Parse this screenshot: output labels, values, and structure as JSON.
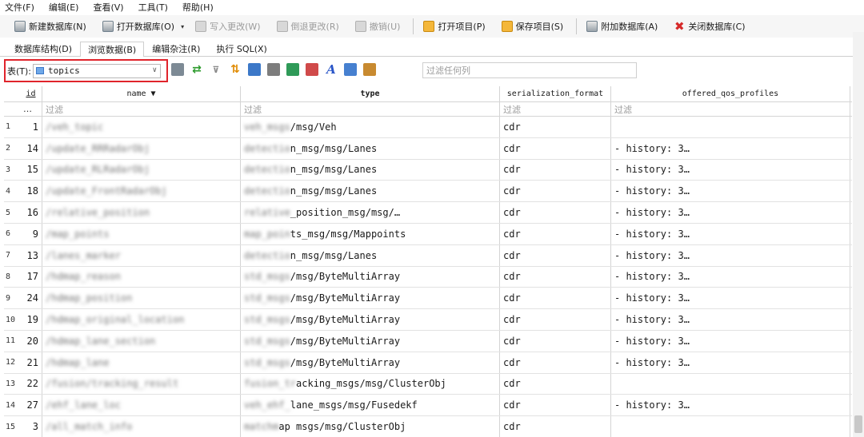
{
  "menu": [
    "文件(F)",
    "编辑(E)",
    "查看(V)",
    "工具(T)",
    "帮助(H)"
  ],
  "toolbar": {
    "new_db": "新建数据库(N)",
    "open_db": "打开数据库(O)",
    "write_changes": "写入更改(W)",
    "revert_changes": "倒退更改(R)",
    "undo": "撤销(U)",
    "open_project": "打开项目(P)",
    "save_project": "保存项目(S)",
    "attach_db": "附加数据库(A)",
    "close_db": "关闭数据库(C)"
  },
  "tabs": [
    "数据库结构(D)",
    "浏览数据(B)",
    "编辑杂注(R)",
    "执行 SQL(X)"
  ],
  "active_tab": 1,
  "table_selector": {
    "label": "表(T):",
    "value": "topics"
  },
  "filter_any_placeholder": "过滤任何列",
  "columns": {
    "id": "id",
    "name": "name ▼",
    "type": "type",
    "serialization_format": "serialization_format",
    "offered_qos_profiles": "offered_qos_profiles"
  },
  "filter_row": {
    "rownum": "…",
    "placeholder": "过滤"
  },
  "rows": [
    {
      "rn": "1",
      "id": "1",
      "name": "/veh_topic",
      "type_prefix": "veh_msgs",
      "type": "/msg/Veh",
      "ser": "cdr",
      "qos": ""
    },
    {
      "rn": "2",
      "id": "14",
      "name": "/update_RRRadarObj",
      "type_prefix": "detectio",
      "type": "n_msg/msg/Lanes",
      "ser": "cdr",
      "qos": "- history: 3…"
    },
    {
      "rn": "3",
      "id": "15",
      "name": "/update_RLRadarObj",
      "type_prefix": "detectio",
      "type": "n_msg/msg/Lanes",
      "ser": "cdr",
      "qos": "- history: 3…"
    },
    {
      "rn": "4",
      "id": "18",
      "name": "/update_FrontRadarObj",
      "type_prefix": "detectio",
      "type": "n_msg/msg/Lanes",
      "ser": "cdr",
      "qos": "- history: 3…"
    },
    {
      "rn": "5",
      "id": "16",
      "name": "/relative_position",
      "type_prefix": "relative",
      "type": "_position_msg/msg/…",
      "ser": "cdr",
      "qos": "- history: 3…"
    },
    {
      "rn": "6",
      "id": "9",
      "name": "/map_points",
      "type_prefix": "map_poin",
      "type": "ts_msg/msg/Mappoints",
      "ser": "cdr",
      "qos": "- history: 3…"
    },
    {
      "rn": "7",
      "id": "13",
      "name": "/lanes_marker",
      "type_prefix": "detectio",
      "type": "n_msg/msg/Lanes",
      "ser": "cdr",
      "qos": "- history: 3…"
    },
    {
      "rn": "8",
      "id": "17",
      "name": "/hdmap_reason",
      "type_prefix": "std_msgs",
      "type": "/msg/ByteMultiArray",
      "ser": "cdr",
      "qos": "- history: 3…"
    },
    {
      "rn": "9",
      "id": "24",
      "name": "/hdmap_position",
      "type_prefix": "std_msgs",
      "type": "/msg/ByteMultiArray",
      "ser": "cdr",
      "qos": "- history: 3…"
    },
    {
      "rn": "10",
      "id": "19",
      "name": "/hdmap_original_location",
      "type_prefix": "std_msgs",
      "type": "/msg/ByteMultiArray",
      "ser": "cdr",
      "qos": "- history: 3…"
    },
    {
      "rn": "11",
      "id": "20",
      "name": "/hdmap_lane_section",
      "type_prefix": "std_msgs",
      "type": "/msg/ByteMultiArray",
      "ser": "cdr",
      "qos": "- history: 3…"
    },
    {
      "rn": "12",
      "id": "21",
      "name": "/hdmap_lane",
      "type_prefix": "std_msgs",
      "type": "/msg/ByteMultiArray",
      "ser": "cdr",
      "qos": "- history: 3…"
    },
    {
      "rn": "13",
      "id": "22",
      "name": "/fusion/tracking_result",
      "type_prefix": "fusion_tr",
      "type": "acking_msgs/msg/ClusterObj",
      "ser": "cdr",
      "qos": ""
    },
    {
      "rn": "14",
      "id": "27",
      "name": "/ehf_lane_loc",
      "type_prefix": "veh_ehf_",
      "type": "lane_msgs/msg/Fusedekf",
      "ser": "cdr",
      "qos": "- history: 3…"
    },
    {
      "rn": "15",
      "id": "3",
      "name": "/all_match_info",
      "type_prefix": "matchm",
      "type": "ap msgs/msg/ClusterObj",
      "ser": "cdr",
      "qos": ""
    }
  ]
}
